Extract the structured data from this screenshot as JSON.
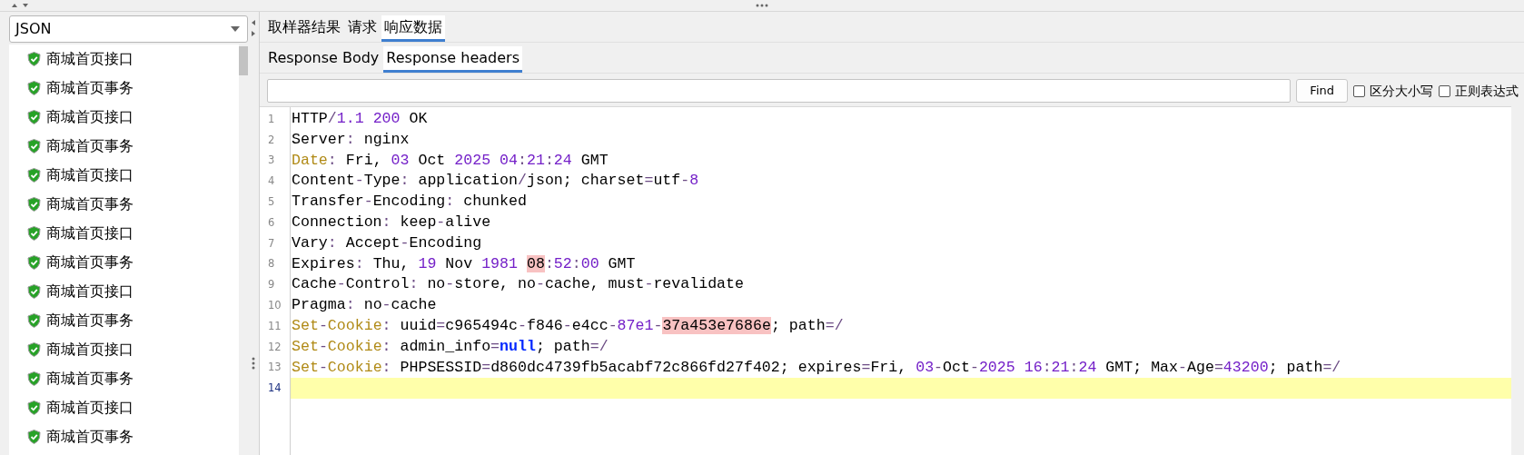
{
  "sampler_filter": {
    "value": "JSON"
  },
  "samples": [
    {
      "label": "商城首页接口"
    },
    {
      "label": "商城首页事务"
    },
    {
      "label": "商城首页接口"
    },
    {
      "label": "商城首页事务"
    },
    {
      "label": "商城首页接口"
    },
    {
      "label": "商城首页事务"
    },
    {
      "label": "商城首页接口"
    },
    {
      "label": "商城首页事务"
    },
    {
      "label": "商城首页接口"
    },
    {
      "label": "商城首页事务"
    },
    {
      "label": "商城首页接口"
    },
    {
      "label": "商城首页事务"
    },
    {
      "label": "商城首页接口"
    },
    {
      "label": "商城首页事务"
    }
  ],
  "tabs": [
    {
      "label": "取样器结果",
      "selected": false
    },
    {
      "label": "请求",
      "selected": false
    },
    {
      "label": "响应数据",
      "selected": true
    }
  ],
  "subtabs": [
    {
      "label": "Response Body",
      "selected": false
    },
    {
      "label": "Response headers",
      "selected": true
    }
  ],
  "search": {
    "button": "Find",
    "options": [
      {
        "label": "区分大小写",
        "checked": false
      },
      {
        "label": "正则表达式",
        "checked": false
      }
    ]
  },
  "lines": [
    {
      "number": "1",
      "current": false,
      "tokens": [
        {
          "kind": "text",
          "text": "HTTP"
        },
        {
          "kind": "punct",
          "text": "/"
        },
        {
          "kind": "number",
          "text": "1.1 "
        },
        {
          "kind": "number",
          "text": "200"
        },
        {
          "kind": "text",
          "text": " OK"
        }
      ]
    },
    {
      "number": "2",
      "current": false,
      "tokens": [
        {
          "kind": "text",
          "text": "Server"
        },
        {
          "kind": "punct",
          "text": ":"
        },
        {
          "kind": "text",
          "text": " nginx"
        }
      ]
    },
    {
      "number": "3",
      "current": false,
      "tokens": [
        {
          "kind": "header",
          "text": "Date"
        },
        {
          "kind": "punct",
          "text": ":"
        },
        {
          "kind": "text",
          "text": " Fri, "
        },
        {
          "kind": "number",
          "text": "03"
        },
        {
          "kind": "text",
          "text": " Oct "
        },
        {
          "kind": "number",
          "text": "2025 "
        },
        {
          "kind": "number",
          "text": "04"
        },
        {
          "kind": "punct",
          "text": ":"
        },
        {
          "kind": "number",
          "text": "21"
        },
        {
          "kind": "punct",
          "text": ":"
        },
        {
          "kind": "number",
          "text": "24"
        },
        {
          "kind": "text",
          "text": " GMT"
        }
      ]
    },
    {
      "number": "4",
      "current": false,
      "tokens": [
        {
          "kind": "text",
          "text": "Content"
        },
        {
          "kind": "punct",
          "text": "-"
        },
        {
          "kind": "text",
          "text": "Type"
        },
        {
          "kind": "punct",
          "text": ":"
        },
        {
          "kind": "text",
          "text": " application"
        },
        {
          "kind": "punct",
          "text": "/"
        },
        {
          "kind": "text",
          "text": "json; charset"
        },
        {
          "kind": "punct",
          "text": "="
        },
        {
          "kind": "text",
          "text": "utf"
        },
        {
          "kind": "punct",
          "text": "-"
        },
        {
          "kind": "number",
          "text": "8"
        }
      ]
    },
    {
      "number": "5",
      "current": false,
      "tokens": [
        {
          "kind": "text",
          "text": "Transfer"
        },
        {
          "kind": "punct",
          "text": "-"
        },
        {
          "kind": "text",
          "text": "Encoding"
        },
        {
          "kind": "punct",
          "text": ":"
        },
        {
          "kind": "text",
          "text": " chunked"
        }
      ]
    },
    {
      "number": "6",
      "current": false,
      "tokens": [
        {
          "kind": "text",
          "text": "Connection"
        },
        {
          "kind": "punct",
          "text": ":"
        },
        {
          "kind": "text",
          "text": " keep"
        },
        {
          "kind": "punct",
          "text": "-"
        },
        {
          "kind": "text",
          "text": "alive"
        }
      ]
    },
    {
      "number": "7",
      "current": false,
      "tokens": [
        {
          "kind": "text",
          "text": "Vary"
        },
        {
          "kind": "punct",
          "text": ":"
        },
        {
          "kind": "text",
          "text": " Accept"
        },
        {
          "kind": "punct",
          "text": "-"
        },
        {
          "kind": "text",
          "text": "Encoding"
        }
      ]
    },
    {
      "number": "8",
      "current": false,
      "tokens": [
        {
          "kind": "text",
          "text": "Expires"
        },
        {
          "kind": "punct",
          "text": ":"
        },
        {
          "kind": "text",
          "text": " Thu, "
        },
        {
          "kind": "number",
          "text": "19"
        },
        {
          "kind": "text",
          "text": " Nov "
        },
        {
          "kind": "number",
          "text": "1981 "
        },
        {
          "kind": "match",
          "text": "08"
        },
        {
          "kind": "punct",
          "text": ":"
        },
        {
          "kind": "number",
          "text": "52"
        },
        {
          "kind": "punct",
          "text": ":"
        },
        {
          "kind": "number",
          "text": "00"
        },
        {
          "kind": "text",
          "text": " GMT"
        }
      ]
    },
    {
      "number": "9",
      "current": false,
      "tokens": [
        {
          "kind": "text",
          "text": "Cache"
        },
        {
          "kind": "punct",
          "text": "-"
        },
        {
          "kind": "text",
          "text": "Control"
        },
        {
          "kind": "punct",
          "text": ":"
        },
        {
          "kind": "text",
          "text": " no"
        },
        {
          "kind": "punct",
          "text": "-"
        },
        {
          "kind": "text",
          "text": "store, no"
        },
        {
          "kind": "punct",
          "text": "-"
        },
        {
          "kind": "text",
          "text": "cache, must"
        },
        {
          "kind": "punct",
          "text": "-"
        },
        {
          "kind": "text",
          "text": "revalidate"
        }
      ]
    },
    {
      "number": "10",
      "current": false,
      "tokens": [
        {
          "kind": "text",
          "text": "Pragma"
        },
        {
          "kind": "punct",
          "text": ":"
        },
        {
          "kind": "text",
          "text": " no"
        },
        {
          "kind": "punct",
          "text": "-"
        },
        {
          "kind": "text",
          "text": "cache"
        }
      ]
    },
    {
      "number": "11",
      "current": false,
      "tokens": [
        {
          "kind": "header",
          "text": "Set"
        },
        {
          "kind": "punct",
          "text": "-"
        },
        {
          "kind": "header",
          "text": "Cookie"
        },
        {
          "kind": "punct",
          "text": ":"
        },
        {
          "kind": "text",
          "text": " uuid"
        },
        {
          "kind": "punct",
          "text": "="
        },
        {
          "kind": "text",
          "text": "c965494c"
        },
        {
          "kind": "punct",
          "text": "-"
        },
        {
          "kind": "text",
          "text": "f846"
        },
        {
          "kind": "punct",
          "text": "-"
        },
        {
          "kind": "text",
          "text": "e4cc"
        },
        {
          "kind": "punct",
          "text": "-"
        },
        {
          "kind": "number",
          "text": "87e1"
        },
        {
          "kind": "punct",
          "text": "-"
        },
        {
          "kind": "match",
          "text": "37a453e7686e"
        },
        {
          "kind": "text",
          "text": "; path"
        },
        {
          "kind": "punct",
          "text": "="
        },
        {
          "kind": "punct",
          "text": "/"
        }
      ]
    },
    {
      "number": "12",
      "current": false,
      "tokens": [
        {
          "kind": "header",
          "text": "Set"
        },
        {
          "kind": "punct",
          "text": "-"
        },
        {
          "kind": "header",
          "text": "Cookie"
        },
        {
          "kind": "punct",
          "text": ":"
        },
        {
          "kind": "text",
          "text": " admin_info"
        },
        {
          "kind": "punct",
          "text": "="
        },
        {
          "kind": "keyword",
          "text": "null"
        },
        {
          "kind": "text",
          "text": "; path"
        },
        {
          "kind": "punct",
          "text": "="
        },
        {
          "kind": "punct",
          "text": "/"
        }
      ]
    },
    {
      "number": "13",
      "current": false,
      "tokens": [
        {
          "kind": "header",
          "text": "Set"
        },
        {
          "kind": "punct",
          "text": "-"
        },
        {
          "kind": "header",
          "text": "Cookie"
        },
        {
          "kind": "punct",
          "text": ":"
        },
        {
          "kind": "text",
          "text": " PHPSESSID"
        },
        {
          "kind": "punct",
          "text": "="
        },
        {
          "kind": "text",
          "text": "d860dc4739fb5acabf72c866fd27f402; expires"
        },
        {
          "kind": "punct",
          "text": "="
        },
        {
          "kind": "text",
          "text": "Fri, "
        },
        {
          "kind": "number",
          "text": "03"
        },
        {
          "kind": "punct",
          "text": "-"
        },
        {
          "kind": "text",
          "text": "Oct"
        },
        {
          "kind": "punct",
          "text": "-"
        },
        {
          "kind": "number",
          "text": "2025 "
        },
        {
          "kind": "number",
          "text": "16"
        },
        {
          "kind": "punct",
          "text": ":"
        },
        {
          "kind": "number",
          "text": "21"
        },
        {
          "kind": "punct",
          "text": ":"
        },
        {
          "kind": "number",
          "text": "24"
        },
        {
          "kind": "text",
          "text": " GMT; Max"
        },
        {
          "kind": "punct",
          "text": "-"
        },
        {
          "kind": "text",
          "text": "Age"
        },
        {
          "kind": "punct",
          "text": "="
        },
        {
          "kind": "number",
          "text": "43200"
        },
        {
          "kind": "text",
          "text": "; path"
        },
        {
          "kind": "punct",
          "text": "="
        },
        {
          "kind": "punct",
          "text": "/"
        }
      ]
    },
    {
      "number": "14",
      "current": true
    }
  ]
}
